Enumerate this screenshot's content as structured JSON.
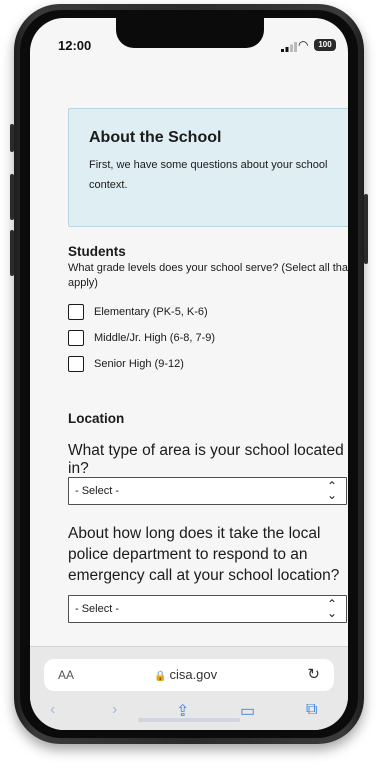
{
  "status_bar": {
    "time": "12:00",
    "battery": "100"
  },
  "intro_card": {
    "title": "About the School",
    "text": "First, we have some questions about your school context."
  },
  "students": {
    "heading": "Students",
    "question": "What grade levels does your school serve? (Select all that apply)",
    "options": [
      "Elementary (PK-5, K-6)",
      "Middle/Jr. High (6-8, 7-9)",
      "Senior High (9-12)"
    ]
  },
  "location": {
    "heading": "Location",
    "area_question": "What type of area is your school located in?",
    "area_select": "- Select -",
    "police_question": "About how long does it take the local police department to respond to an emergency call at your school location?",
    "police_select": "- Select -"
  },
  "browser": {
    "text_size": "AA",
    "domain": "cisa.gov",
    "icons": {
      "reload": "reload-icon",
      "back": "chevron-left-icon",
      "forward": "chevron-right-icon",
      "share": "share-icon",
      "bookmarks": "book-icon",
      "tabs": "tabs-icon"
    }
  }
}
